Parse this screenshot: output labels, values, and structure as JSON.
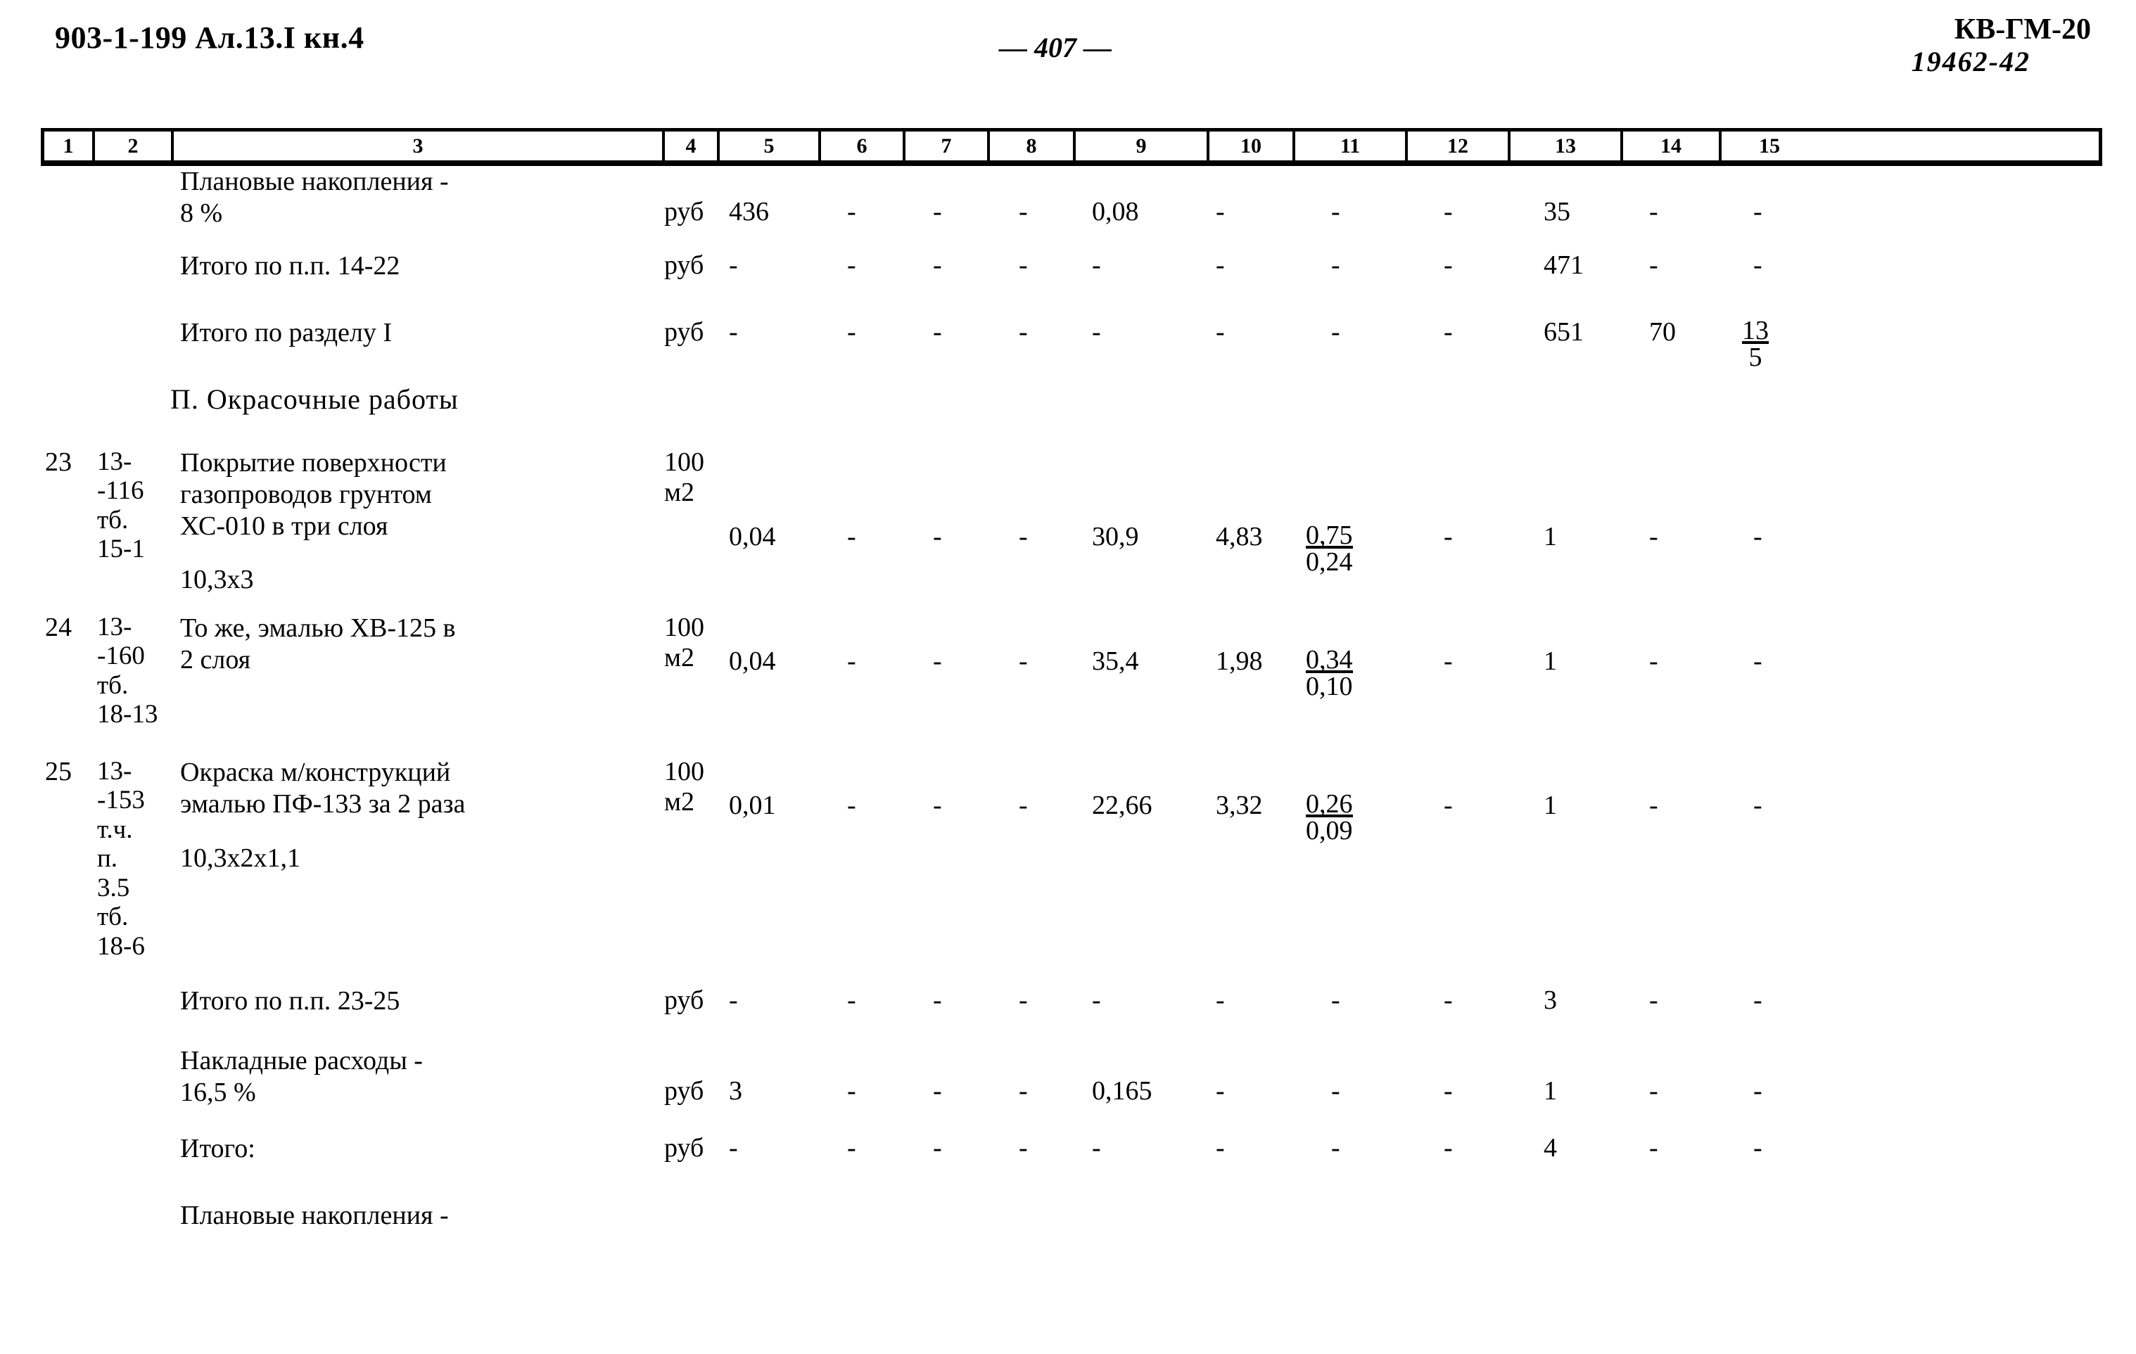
{
  "header": {
    "doc_code": "903-1-199 Ал.13.I кн.4",
    "page_number": "— 407 —",
    "sheet_code": "КВ-ГМ-20",
    "archive_number": "19462-42"
  },
  "table": {
    "column_headers": [
      "1",
      "2",
      "3",
      "4",
      "5",
      "6",
      "7",
      "8",
      "9",
      "10",
      "11",
      "12",
      "13",
      "14",
      "15"
    ],
    "section_heading": "П. Окрасочные работы",
    "rows": [
      {
        "no": "",
        "code": "",
        "desc": "Плановые накопления -\n8 %",
        "extra": "",
        "unit": "руб",
        "c5": "436",
        "c6": "-",
        "c7": "-",
        "c8": "-",
        "c9": "0,08",
        "c10": "-",
        "c11": "-",
        "c11b": "",
        "c12": "-",
        "c13": "35",
        "c14": "-",
        "c15": "-",
        "c15b": ""
      },
      {
        "no": "",
        "code": "",
        "desc": "Итого по п.п. 14-22",
        "extra": "",
        "unit": "руб",
        "c5": "-",
        "c6": "-",
        "c7": "-",
        "c8": "-",
        "c9": "-",
        "c10": "-",
        "c11": "-",
        "c11b": "",
        "c12": "-",
        "c13": "471",
        "c14": "-",
        "c15": "-",
        "c15b": ""
      },
      {
        "no": "",
        "code": "",
        "desc": "Итого по разделу I",
        "extra": "",
        "unit": "руб",
        "c5": "-",
        "c6": "-",
        "c7": "-",
        "c8": "-",
        "c9": "-",
        "c10": "-",
        "c11": "-",
        "c11b": "",
        "c12": "-",
        "c13": "651",
        "c14": "70",
        "c15": "13",
        "c15b": "5"
      },
      {
        "no": "23",
        "code": "13-\n-116\nтб.\n15-1",
        "desc": "Покрытие поверхности\nгазопроводов грунтом\nХС-010 в три слоя",
        "extra": "10,3х3",
        "unit": "100\nм2",
        "c5": "0,04",
        "c6": "-",
        "c7": "-",
        "c8": "-",
        "c9": "30,9",
        "c10": "4,83",
        "c11": "0,75",
        "c11b": "0,24",
        "c12": "-",
        "c13": "1",
        "c14": "-",
        "c15": "-",
        "c15b": ""
      },
      {
        "no": "24",
        "code": "13-\n-160\nтб.\n18-13",
        "desc": "То же, эмалью ХВ-125 в\n2 слоя",
        "extra": "",
        "unit": "100\nм2",
        "c5": "0,04",
        "c6": "-",
        "c7": "-",
        "c8": "-",
        "c9": "35,4",
        "c10": "1,98",
        "c11": "0,34",
        "c11b": "0,10",
        "c12": "-",
        "c13": "1",
        "c14": "-",
        "c15": "-",
        "c15b": ""
      },
      {
        "no": "25",
        "code": "13-\n-153\nт.ч.\nп.\n3.5\nтб.\n18-6",
        "desc": "Окраска м/конструкций\nэмалью ПФ-133 за 2 раза",
        "extra": "10,3х2х1,1",
        "unit": "100\nм2",
        "c5": "0,01",
        "c6": "-",
        "c7": "-",
        "c8": "-",
        "c9": "22,66",
        "c10": "3,32",
        "c11": "0,26",
        "c11b": "0,09",
        "c12": "-",
        "c13": "1",
        "c14": "-",
        "c15": "-",
        "c15b": ""
      },
      {
        "no": "",
        "code": "",
        "desc": "Итого по п.п. 23-25",
        "extra": "",
        "unit": "руб",
        "c5": "-",
        "c6": "-",
        "c7": "-",
        "c8": "-",
        "c9": "-",
        "c10": "-",
        "c11": "-",
        "c11b": "",
        "c12": "-",
        "c13": "3",
        "c14": "-",
        "c15": "-",
        "c15b": ""
      },
      {
        "no": "",
        "code": "",
        "desc": "Накладные расходы -\n16,5 %",
        "extra": "",
        "unit": "руб",
        "c5": "3",
        "c6": "-",
        "c7": "-",
        "c8": "-",
        "c9": "0,165",
        "c10": "-",
        "c11": "-",
        "c11b": "",
        "c12": "-",
        "c13": "1",
        "c14": "-",
        "c15": "-",
        "c15b": ""
      },
      {
        "no": "",
        "code": "",
        "desc": "Итого:",
        "extra": "",
        "unit": "руб",
        "c5": "-",
        "c6": "-",
        "c7": "-",
        "c8": "-",
        "c9": "-",
        "c10": "-",
        "c11": "-",
        "c11b": "",
        "c12": "-",
        "c13": "4",
        "c14": "-",
        "c15": "-",
        "c15b": ""
      },
      {
        "no": "",
        "code": "",
        "desc": "Плановые накопления -",
        "extra": "",
        "unit": "",
        "c5": "",
        "c6": "",
        "c7": "",
        "c8": "",
        "c9": "",
        "c10": "",
        "c11": "",
        "c11b": "",
        "c12": "",
        "c13": "",
        "c14": "",
        "c15": "",
        "c15b": ""
      }
    ]
  }
}
